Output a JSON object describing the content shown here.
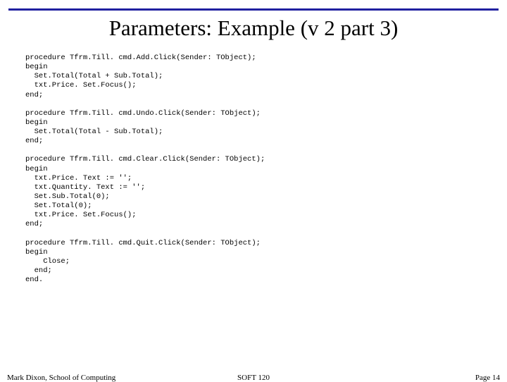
{
  "title": "Parameters: Example (v 2 part 3)",
  "code": "procedure Tfrm.Till. cmd.Add.Click(Sender: TObject);\nbegin\n  Set.Total(Total + Sub.Total);\n  txt.Price. Set.Focus();\nend;\n\nprocedure Tfrm.Till. cmd.Undo.Click(Sender: TObject);\nbegin\n  Set.Total(Total - Sub.Total);\nend;\n\nprocedure Tfrm.Till. cmd.Clear.Click(Sender: TObject);\nbegin\n  txt.Price. Text := '';\n  txt.Quantity. Text := '';\n  Set.Sub.Total(0);\n  Set.Total(0);\n  txt.Price. Set.Focus();\nend;\n\nprocedure Tfrm.Till. cmd.Quit.Click(Sender: TObject);\nbegin\n    Close;\n  end;\nend.",
  "footer": {
    "left": "Mark Dixon, School of Computing",
    "center": "SOFT 120",
    "right": "Page 14"
  }
}
